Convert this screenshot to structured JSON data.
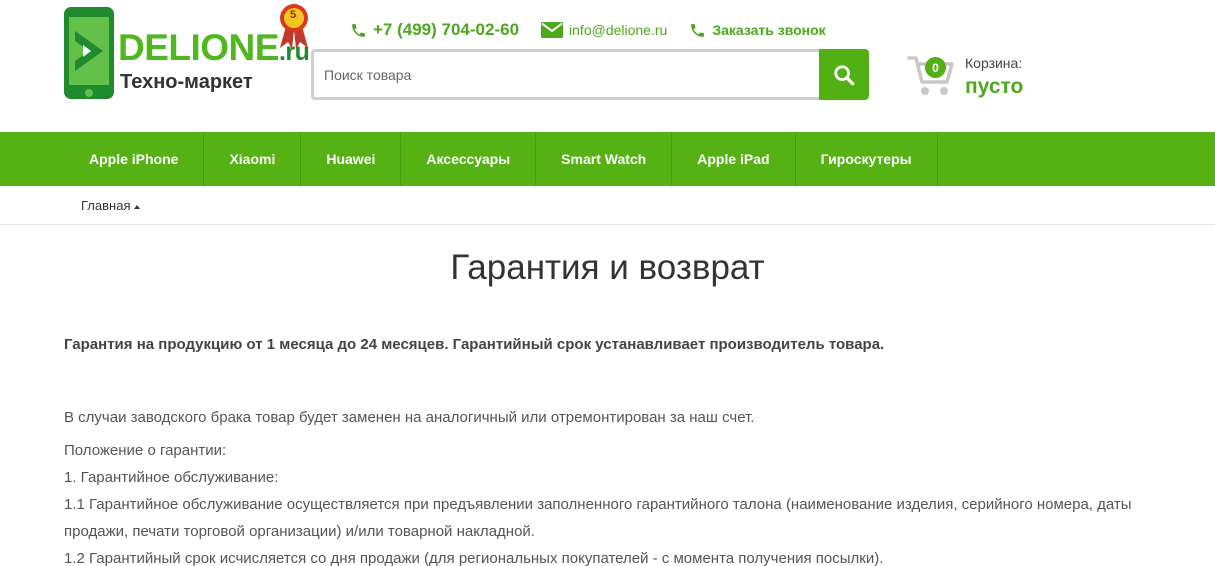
{
  "brand": {
    "name": "DELIONE",
    "tld": ".ru",
    "tagline": "Техно-маркет",
    "medal_number": "5"
  },
  "contacts": {
    "phone": "+7 (499) 704-02-60",
    "email": "info@delione.ru",
    "callback": "Заказать звонок"
  },
  "search": {
    "placeholder": "Поиск товара"
  },
  "cart": {
    "count": "0",
    "label": "Корзина:",
    "status": "пусто"
  },
  "nav": [
    {
      "label": "Apple iPhone"
    },
    {
      "label": "Xiaomi"
    },
    {
      "label": "Huawei"
    },
    {
      "label": "Аксессуары"
    },
    {
      "label": "Smart Watch"
    },
    {
      "label": "Apple iPad"
    },
    {
      "label": "Гироскутеры"
    }
  ],
  "breadcrumb": {
    "home": "Главная"
  },
  "page": {
    "title": "Гарантия и возврат",
    "lead": "Гарантия на продукцию от 1 месяца до 24 месяцев. Гарантийный срок устанавливает производитель товара.",
    "p1": "В случаи заводского брака товар будет заменен на аналогичный или отремонтирован за наш счет.",
    "p2": "Положение о гарантии:",
    "p3": "1. Гарантийное обслуживание:",
    "p4": "1.1 Гарантийное обслуживание осуществляется при предъявлении заполненного гарантийного талона (наименование изделия, серийного номера, даты продажи, печати торговой организации) и/или товарной накладной.",
    "p5": "1.2 Гарантийный срок исчисляется со дня продажи (для региональных покупателей - с момента получения посылки)."
  },
  "colors": {
    "accent": "#55b114",
    "accent_dark": "#1f8a2e",
    "text": "#555555"
  }
}
